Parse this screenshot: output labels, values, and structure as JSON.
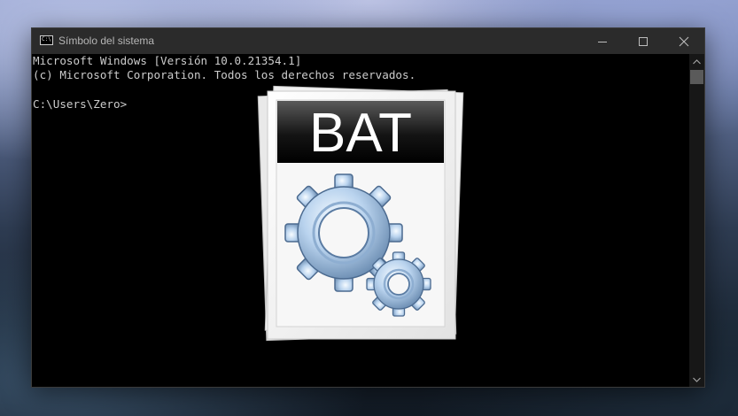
{
  "window": {
    "title": "Símbolo del sistema",
    "app_icon_text": "C:\\",
    "controls": {
      "minimize": "minimize-icon",
      "maximize": "maximize-icon",
      "close": "close-icon"
    }
  },
  "console": {
    "lines": [
      "Microsoft Windows [Versión 10.0.21354.1]",
      "(c) Microsoft Corporation. Todos los derechos reservados.",
      "",
      "C:\\Users\\Zero>"
    ]
  },
  "bat_icon": {
    "label": "BAT",
    "icon": "gears-icon"
  },
  "colors": {
    "console_bg": "#000000",
    "console_text": "#cccccc",
    "titlebar_bg": "#2b2b2b"
  }
}
